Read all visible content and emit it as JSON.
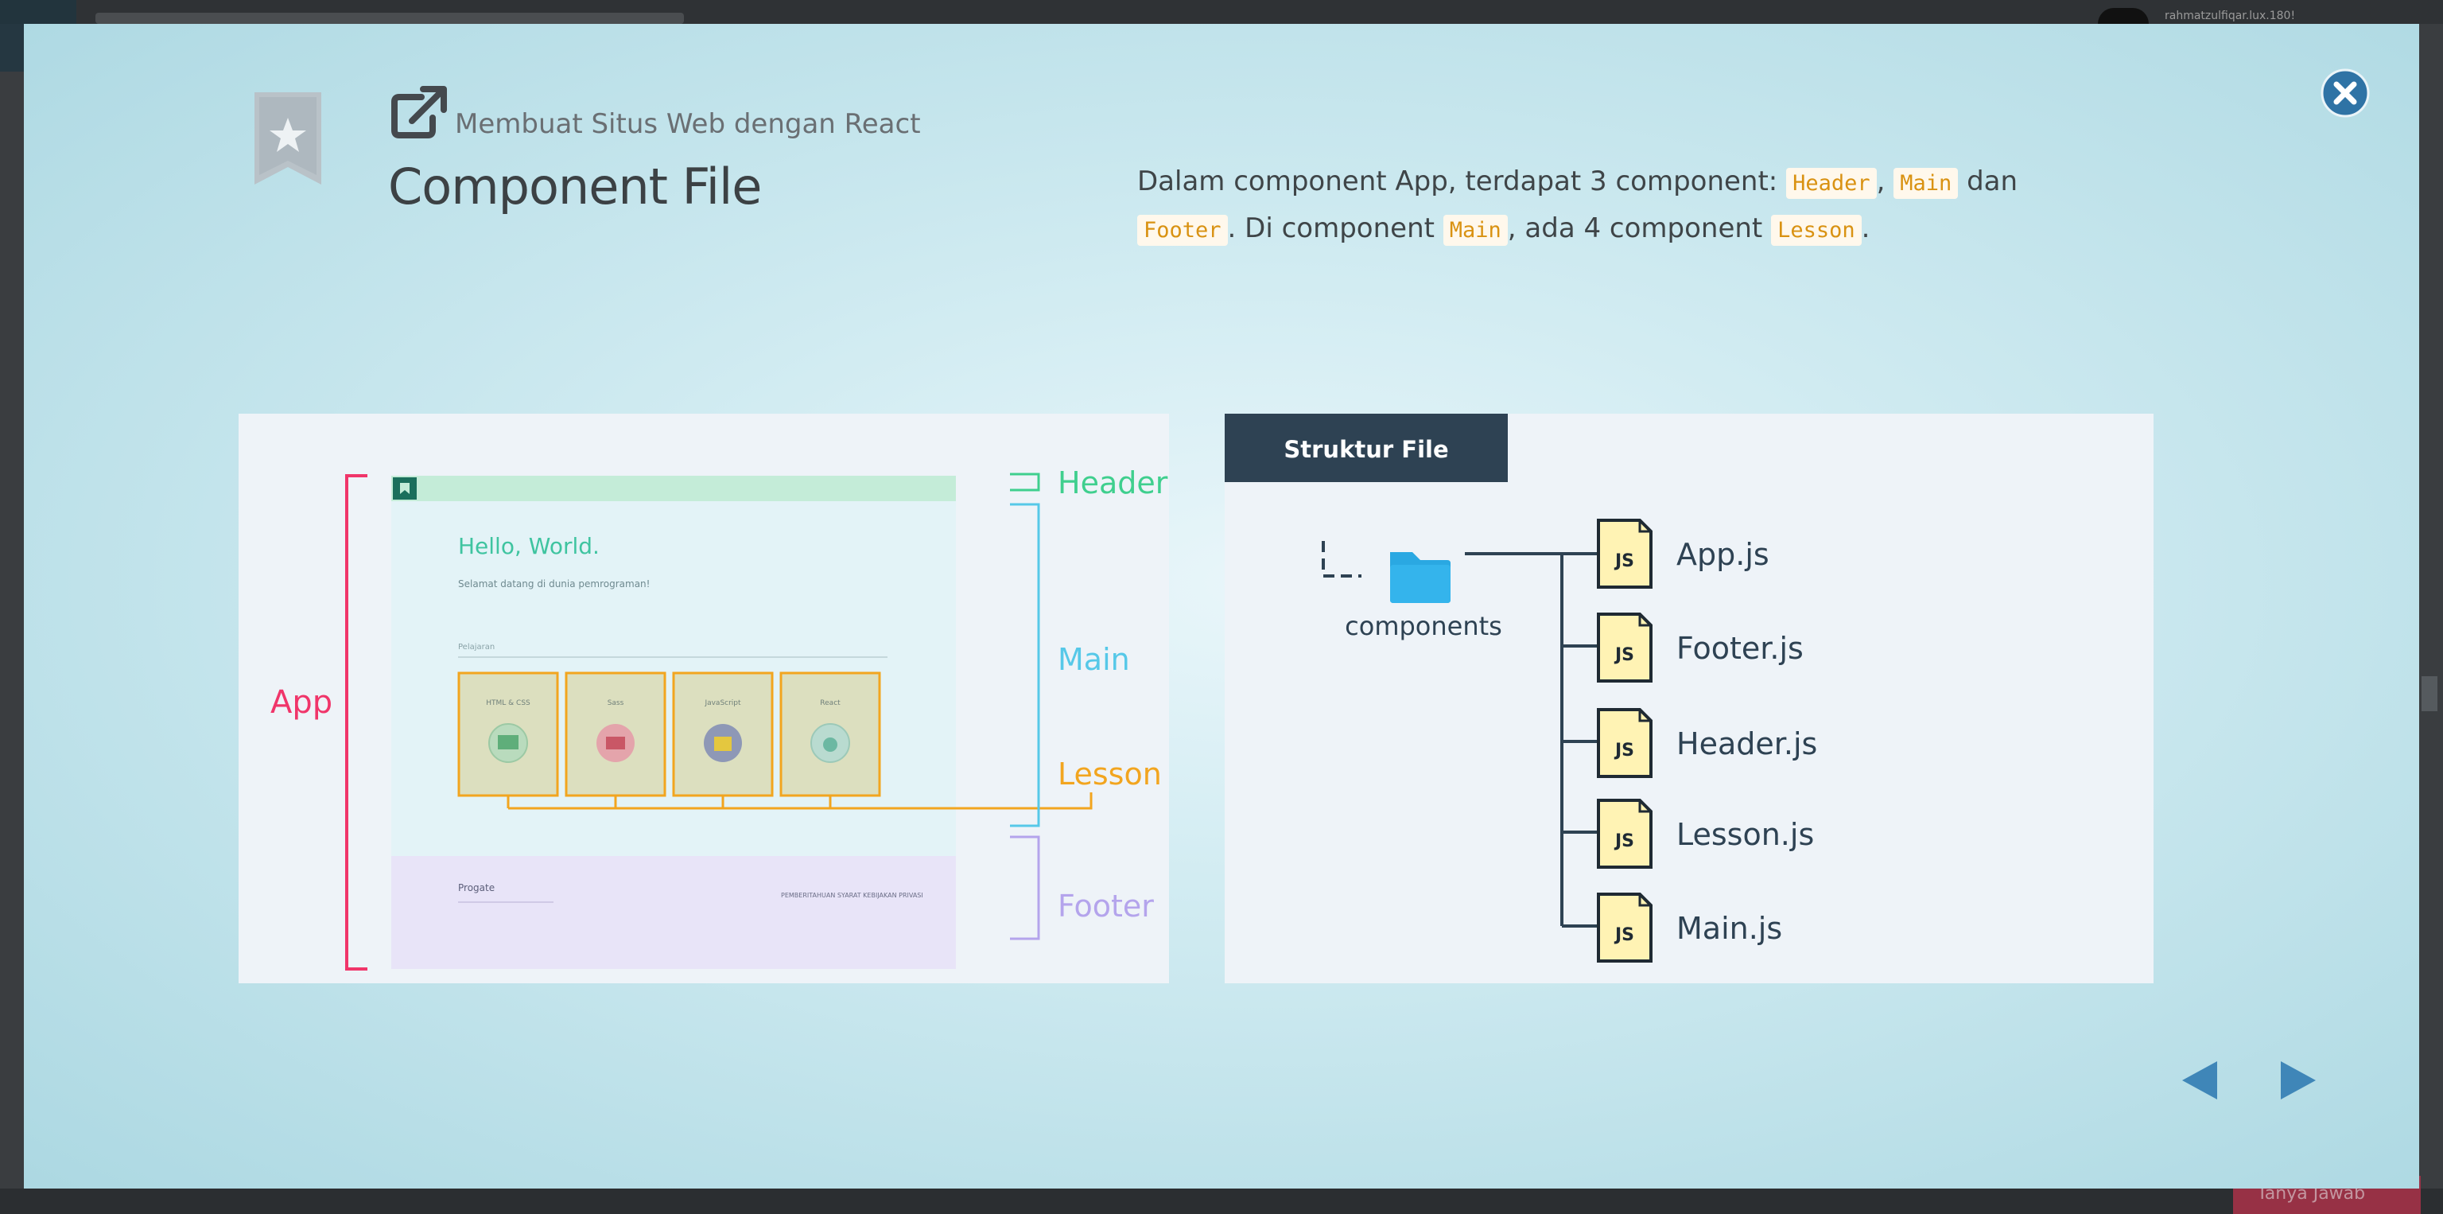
{
  "background": {
    "username": "rahmatzulfiqar.lux.180!",
    "bottom_button": "Tanya Jawab"
  },
  "modal": {
    "course_title": "Membuat Situs Web dengan React",
    "lesson_title": "Component File",
    "description": {
      "part1": "Dalam component App, terdapat 3 component: ",
      "code1": "Header",
      "sep1": ", ",
      "code2": "Main",
      "part2": " dan ",
      "code3": "Footer",
      "part3": ". Di component ",
      "code4": "Main",
      "part4": ", ada 4 component ",
      "code5": "Lesson",
      "part5": "."
    },
    "colors": {
      "app": "#f0356a",
      "header": "#3fcf8e",
      "main": "#56c8e8",
      "lesson": "#f2a51f",
      "footer": "#b4a4ec",
      "folder": "#2aa8e2",
      "file_header": "#2e4253"
    },
    "diagram": {
      "labels": {
        "app": "App",
        "header": "Header",
        "main": "Main",
        "lesson": "Lesson",
        "footer": "Footer"
      },
      "mock": {
        "hello": "Hello, World.",
        "subtitle": "Selamat datang di dunia pemrograman!",
        "section": "Pelajaran",
        "cards": [
          "HTML & CSS",
          "Sass",
          "JavaScript",
          "React"
        ],
        "footer_logo": "Progate",
        "footer_links": "PEMBERITAHUAN   SYARAT   KEBIJAKAN PRIVASI"
      }
    },
    "file_structure": {
      "header": "Struktur File",
      "folder": "components",
      "badge": "JS",
      "files": [
        "App.js",
        "Footer.js",
        "Header.js",
        "Lesson.js",
        "Main.js"
      ]
    },
    "icons": {
      "bookmark": "bookmark-star-icon",
      "external": "external-link-icon",
      "close": "close-circle-icon",
      "prev": "triangle-left-icon",
      "next": "triangle-right-icon"
    }
  }
}
